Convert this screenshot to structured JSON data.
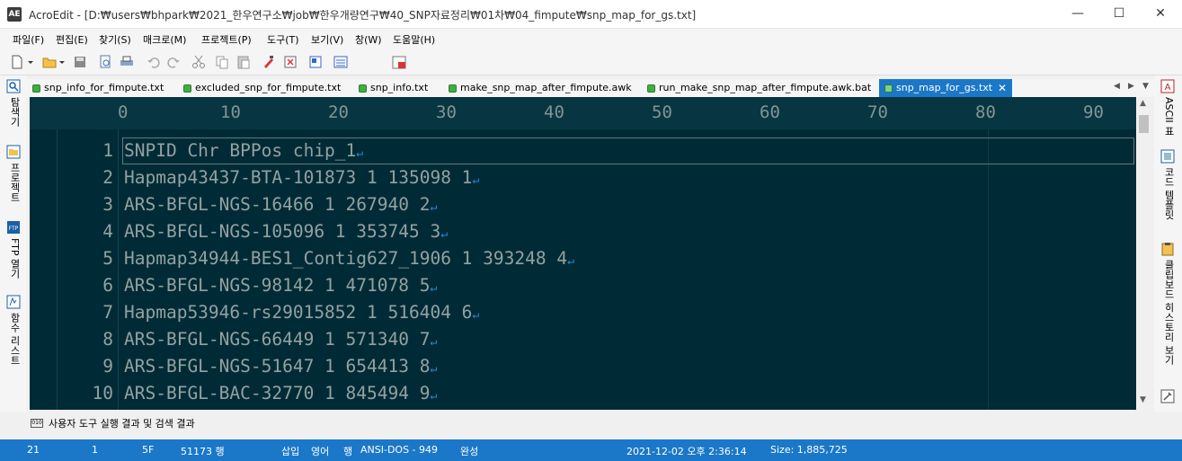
{
  "window": {
    "logo": "AE",
    "title": "AcroEdit - [D:₩users₩bhpark₩2021_한우연구소₩job₩한우개량연구₩40_SNP자료정리₩01차₩04_fimpute₩snp_map_for_gs.txt]",
    "minimize": "—",
    "maximize": "☐",
    "close": "✕"
  },
  "menu": [
    "파일(F)",
    "편집(E)",
    "찾기(S)",
    "매크로(M)",
    "프로젝트(P)",
    "도구(T)",
    "보기(V)",
    "창(W)",
    "도움말(H)"
  ],
  "tabs": [
    {
      "label": "snp_info_for_fimpute.txt",
      "active": false
    },
    {
      "label": "excluded_snp_for_fimpute.txt",
      "active": false
    },
    {
      "label": "snp_info.txt",
      "active": false
    },
    {
      "label": "make_snp_map_after_fimpute.awk",
      "active": false
    },
    {
      "label": "run_make_snp_map_after_fimpute.awk.bat",
      "active": false
    },
    {
      "label": "snp_map_for_gs.txt",
      "active": true
    }
  ],
  "tab_close": "✕",
  "tab_nav": {
    "prev": "◀",
    "next": "▶",
    "menu": "▼"
  },
  "left_panel": {
    "search": "탐색기",
    "project": "프로젝트",
    "ftp": "FTP 열기",
    "functions": "함수 리스트"
  },
  "right_panel": {
    "ascii": "ASCII 표",
    "code_template": "코드 템플릿",
    "clipboard": "클립보드 히스토리 보기"
  },
  "ruler": [
    "0",
    "10",
    "20",
    "30",
    "40",
    "50",
    "60",
    "70",
    "80",
    "90"
  ],
  "editor": {
    "eol_mark": "↵",
    "lines": [
      {
        "num": "1",
        "text": "SNPID Chr BPPos chip_1"
      },
      {
        "num": "2",
        "text": "Hapmap43437-BTA-101873 1 135098 1"
      },
      {
        "num": "3",
        "text": "ARS-BFGL-NGS-16466 1 267940 2"
      },
      {
        "num": "4",
        "text": "ARS-BFGL-NGS-105096 1 353745 3"
      },
      {
        "num": "5",
        "text": "Hapmap34944-BES1_Contig627_1906 1 393248 4"
      },
      {
        "num": "6",
        "text": "ARS-BFGL-NGS-98142 1 471078 5"
      },
      {
        "num": "7",
        "text": "Hapmap53946-rs29015852 1 516404 6"
      },
      {
        "num": "8",
        "text": "ARS-BFGL-NGS-66449 1 571340 7"
      },
      {
        "num": "9",
        "text": "ARS-BFGL-NGS-51647 1 654413 8"
      },
      {
        "num": "10",
        "text": "ARS-BFGL-BAC-32770 1 845494 9"
      }
    ]
  },
  "scroll": {
    "up": "▲",
    "down": "▼"
  },
  "output_panel": {
    "label": "사용자 도구 실행 결과 및 검색 결과",
    "icon_text": "010"
  },
  "status": {
    "line": "21",
    "col": "1",
    "hex": "5F",
    "total_lines": "51173 행",
    "insert": "삽입",
    "lang": "영어",
    "mode": "행",
    "encoding": "ANSI-DOS - 949",
    "state": "완성",
    "datetime": "2021-12-02 오후 2:36:14",
    "size": "Size: 1,885,725"
  },
  "colors": {
    "editor_bg": "#002b36",
    "ruler_bg": "#073642",
    "text": "#93a1a1",
    "eol": "#268bd2",
    "accent": "#1b78c8"
  }
}
